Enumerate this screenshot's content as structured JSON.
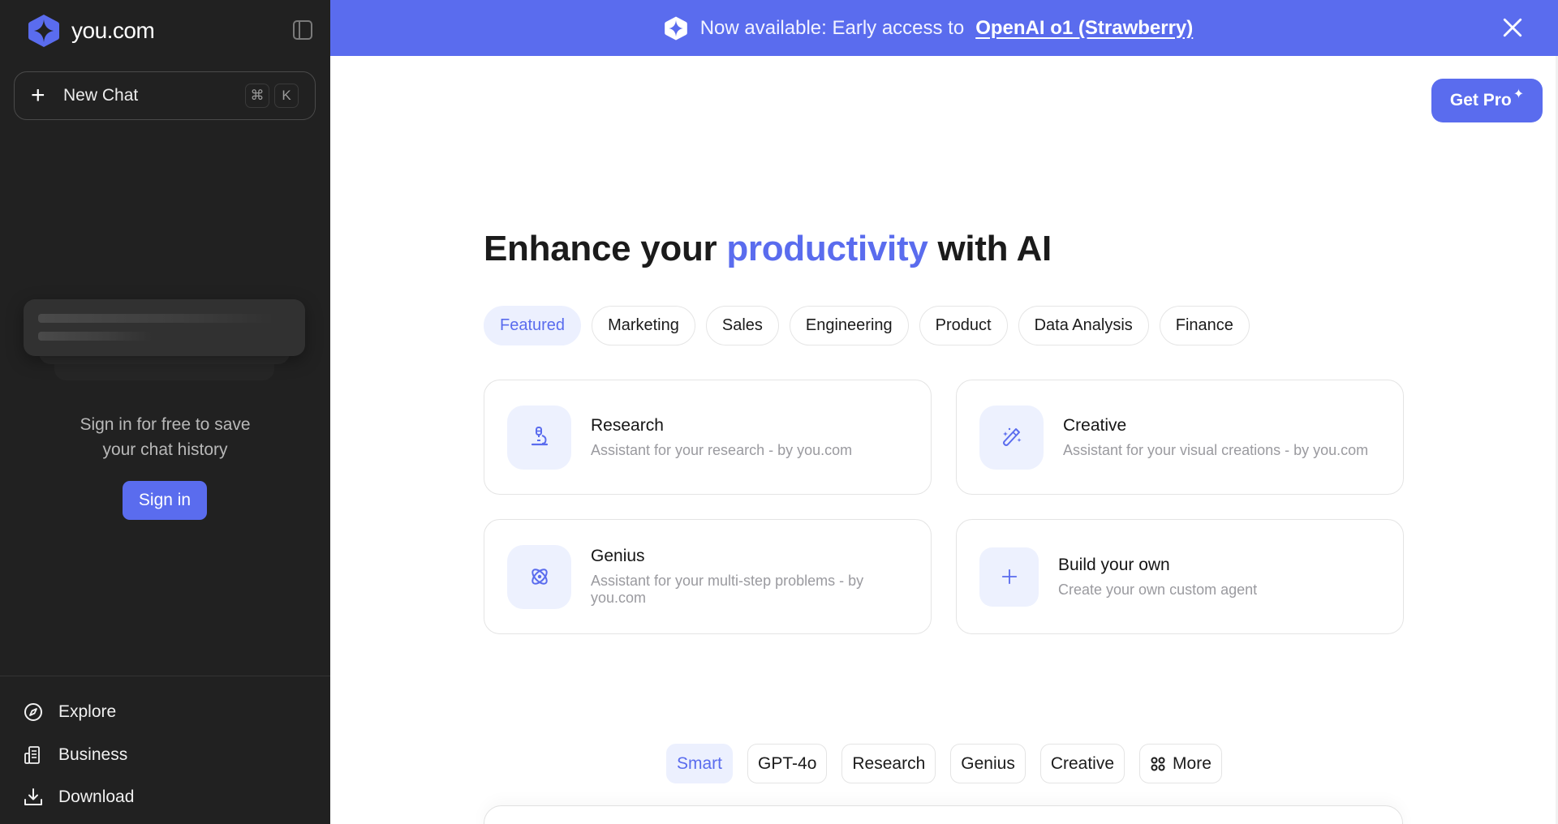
{
  "sidebar": {
    "brand": "you.com",
    "new_chat": {
      "label": "New Chat",
      "shortcut_keys": [
        "⌘",
        "K"
      ]
    },
    "signin_prompt_line1": "Sign in for free to save",
    "signin_prompt_line2": "your chat history",
    "signin_button": "Sign in",
    "nav": [
      {
        "label": "Explore",
        "icon": "compass-icon"
      },
      {
        "label": "Business",
        "icon": "building-icon"
      },
      {
        "label": "Download",
        "icon": "download-icon"
      }
    ]
  },
  "banner": {
    "text": "Now available: Early access to",
    "link": "OpenAI o1 (Strawberry)"
  },
  "header": {
    "get_pro": "Get Pro",
    "get_pro_spark": "✦"
  },
  "main": {
    "headline_pre": "Enhance your",
    "headline_accent": "productivity",
    "headline_post": "with AI",
    "categories": [
      "Featured",
      "Marketing",
      "Sales",
      "Engineering",
      "Product",
      "Data Analysis",
      "Finance"
    ],
    "active_category": "Featured",
    "cards": [
      {
        "title": "Research",
        "desc": "Assistant for your research - by you.com",
        "icon": "microscope-icon"
      },
      {
        "title": "Creative",
        "desc": "Assistant for your visual creations - by you.com",
        "icon": "magic-wand-icon"
      },
      {
        "title": "Genius",
        "desc": "Assistant for your multi-step problems - by you.com",
        "icon": "atom-icon"
      },
      {
        "title": "Build your own",
        "desc": "Create your own custom agent",
        "icon": "plus-icon"
      }
    ],
    "models": [
      "Smart",
      "GPT-4o",
      "Research",
      "Genius",
      "Creative",
      "More"
    ],
    "active_model": "Smart"
  },
  "colors": {
    "accent": "#5a6cee",
    "sidebar_bg": "#212121",
    "accent_soft": "#ecf0fe"
  }
}
